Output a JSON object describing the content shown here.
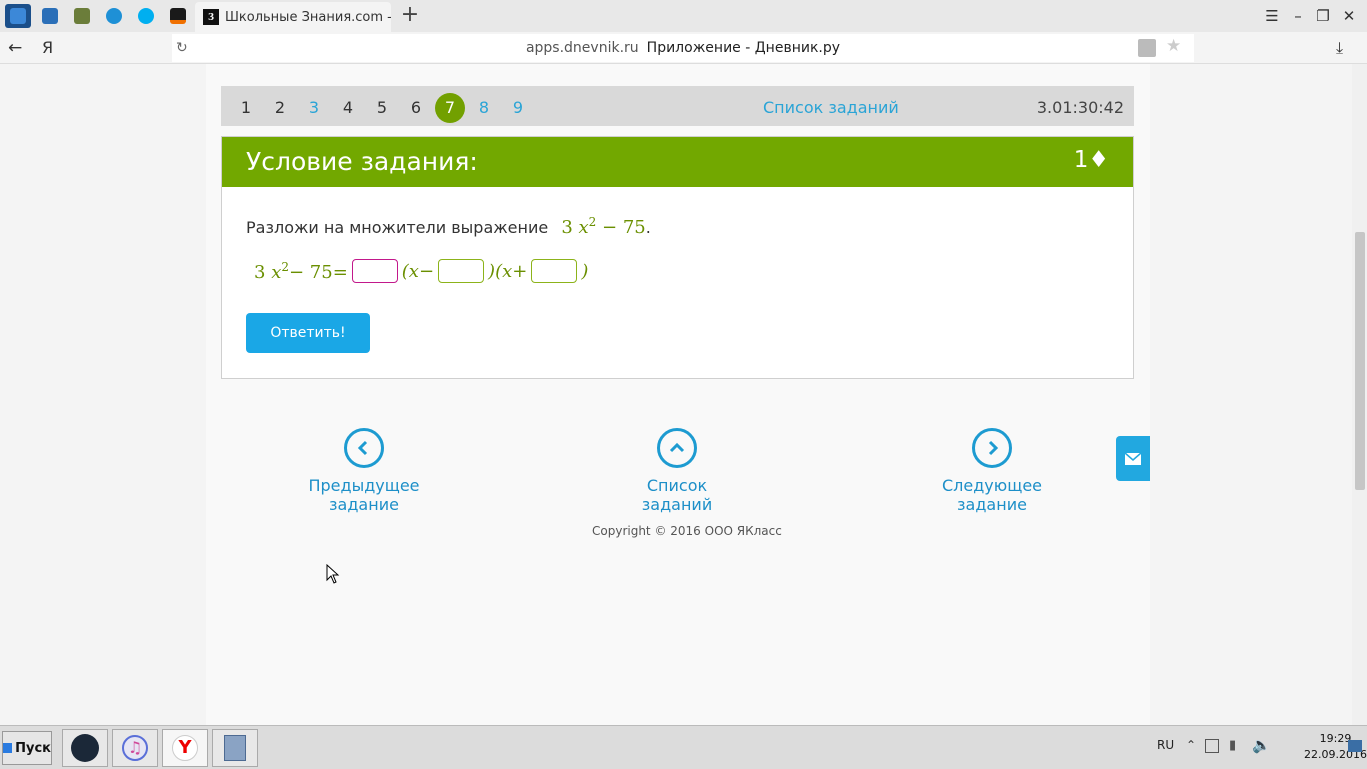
{
  "browser": {
    "tab_title": "Школьные Знания.com - Ре",
    "tab_favicon_letter": "З",
    "url_domain": "apps.dnevnik.ru",
    "url_title": "Приложение - Дневник.ру",
    "address_prefix": "Я"
  },
  "questions": {
    "numbers": [
      "1",
      "2",
      "3",
      "4",
      "5",
      "6",
      "7",
      "8",
      "9"
    ],
    "current": "7",
    "list_link": "Список заданий",
    "timer": "3.01:30:42"
  },
  "task": {
    "header": "Условие задания:",
    "points": "1♦",
    "prompt": "Разложи на множители выражение",
    "expr_coef": "3",
    "expr_var": "x",
    "expr_pow": "2",
    "expr_rest": "− 75",
    "period": ".",
    "eq_left_coef": "3",
    "eq_left_var": "x",
    "eq_left_pow": "2",
    "eq_left_rest": "− 75=",
    "eq_open1": "(x−",
    "eq_close_open": ")(x+",
    "eq_close2": ")",
    "submit_label": "Ответить!"
  },
  "bottom_nav": {
    "prev": "Предыдущее задание",
    "list": "Список заданий",
    "next": "Следующее задание"
  },
  "footer": {
    "copyright": "Copyright © 2016 ООО ЯКласс"
  },
  "taskbar": {
    "start": "Пуск",
    "lang": "RU",
    "time": "19:29",
    "date": "22.09.2016"
  },
  "colors": {
    "accent_green": "#72a800",
    "link_blue": "#2aa4d6",
    "button_blue": "#1aa7e6"
  }
}
